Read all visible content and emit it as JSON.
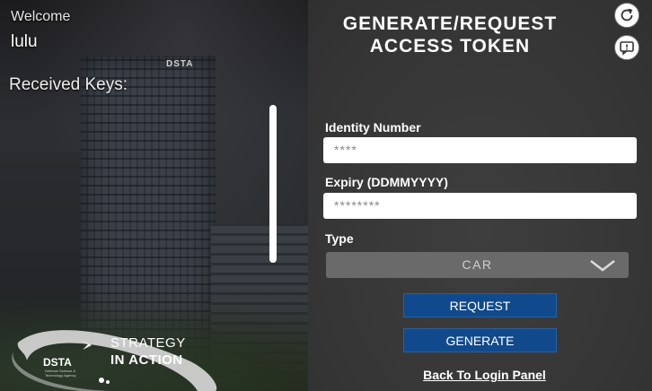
{
  "left_panel": {
    "welcome_label": "Welcome",
    "username": "lulu",
    "received_keys_label": "Received Keys:",
    "building_sign": "DSTA",
    "logo": {
      "dsta": "DSTA",
      "tagline": "Defence Science & Technology Agency",
      "strategy": "STRATEGY",
      "in_action": "IN ACTION"
    }
  },
  "form": {
    "title_line1": "GENERATE/REQUEST",
    "title_line2": "ACCESS TOKEN",
    "identity_label": "Identity Number",
    "identity_value": "****",
    "expiry_label": "Expiry (DDMMYYYY)",
    "expiry_value": "********",
    "type_label": "Type",
    "type_value": "CAR",
    "request_label": "REQUEST",
    "generate_label": "GENERATE",
    "back_label": "Back To Login Panel"
  },
  "icons": {
    "refresh": "refresh-icon",
    "chat": "chat-icon",
    "dropdown": "chevron-down-icon"
  },
  "colors": {
    "button_bg": "#114a8c",
    "panel_bg": "#353535"
  }
}
